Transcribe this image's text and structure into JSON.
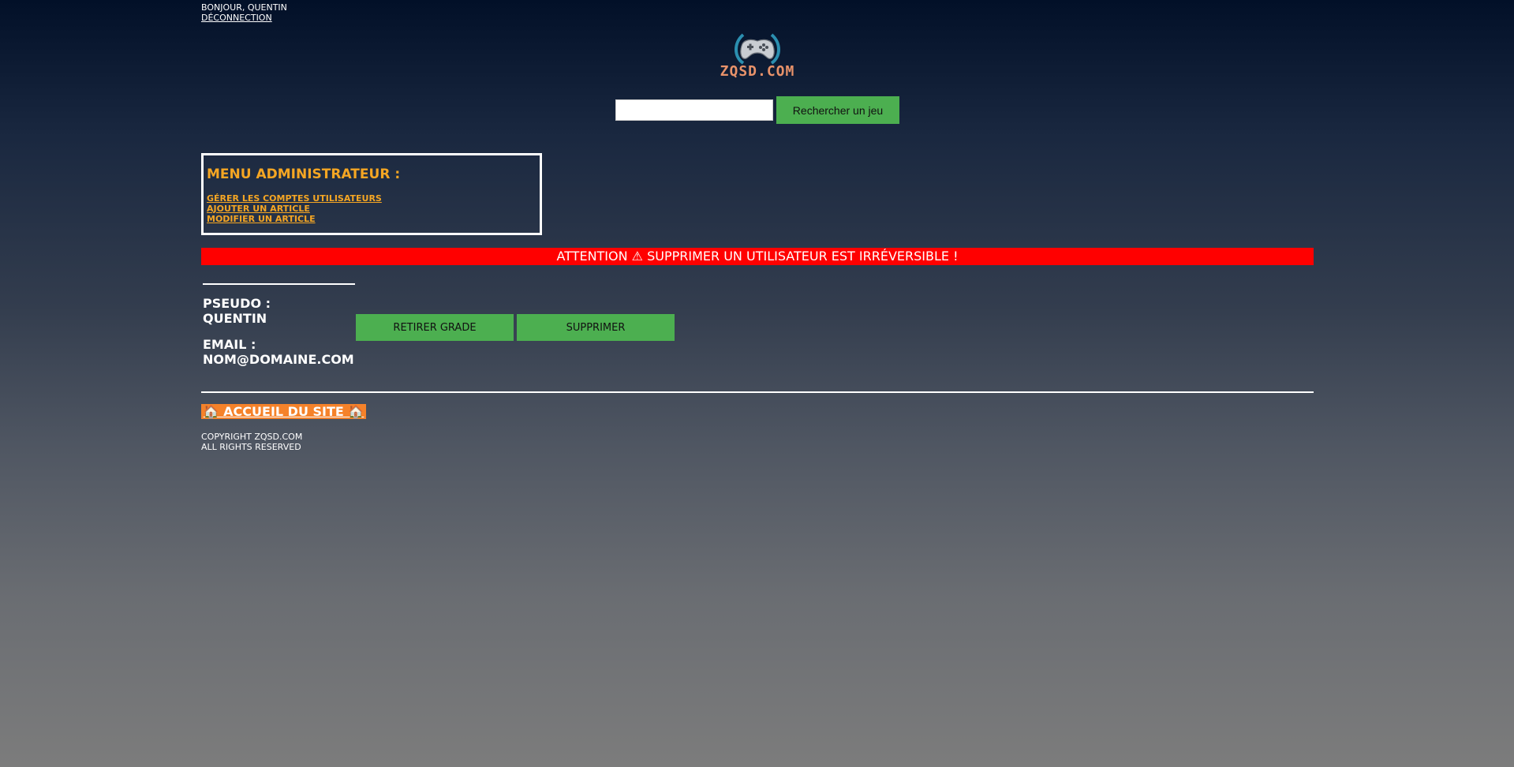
{
  "header": {
    "greeting": "BONJOUR, QUENTIN",
    "logout_label": "DÉCONNECTION",
    "logo_text": "ZQSD.COM",
    "search": {
      "value": "",
      "placeholder": "",
      "button_label": "Rechercher un jeu"
    }
  },
  "admin_menu": {
    "title": "MENU ADMINISTRATEUR :",
    "links": [
      {
        "label": "GÉRER LES COMPTES UTILISATEURS"
      },
      {
        "label": "AJOUTER UN ARTICLE"
      },
      {
        "label": "MODIFIER UN ARTICLE"
      }
    ]
  },
  "warning": "ATTENTION ⚠ SUPPRIMER UN UTILISATEUR EST IRRÉVERSIBLE !",
  "user": {
    "pseudo_label": "PSEUDO :",
    "pseudo_value": "QUENTIN",
    "email_label": "EMAIL :",
    "email_value": "NOM@DOMAINE.COM",
    "actions": {
      "demote_label": "RETIRER GRADE",
      "delete_label": "SUPPRIMER"
    }
  },
  "footer": {
    "home_label": "🏠 ACCUEIL DU SITE 🏠",
    "copyright_line1": "COPYRIGHT ZQSD.COM",
    "copyright_line2": "ALL RIGHTS RESERVED"
  },
  "colors": {
    "accent_green": "#4caf50",
    "warning_red": "#ff0000",
    "admin_orange": "#f5a623",
    "home_orange": "#f5822a",
    "logo_text": "#e8926a"
  },
  "icons": {
    "logo": "gamepad-icon",
    "warning": "warning-icon",
    "home": "house-icon"
  }
}
